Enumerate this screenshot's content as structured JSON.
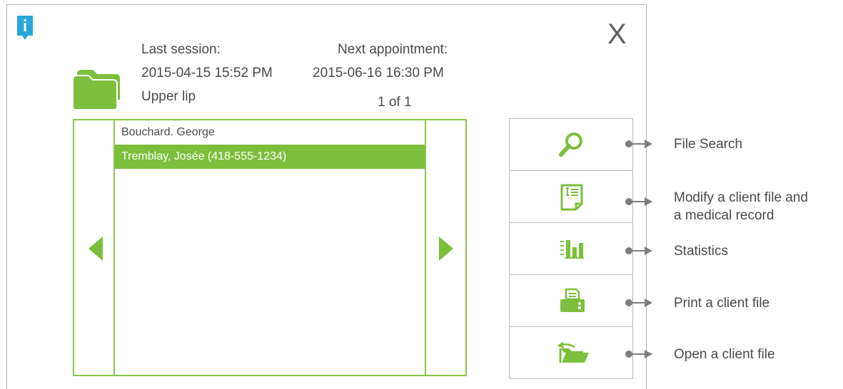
{
  "header": {
    "close_label": "X",
    "last_session_label": "Last session:",
    "next_appointment_label": "Next appointment:",
    "last_session_value": "2015-04-15 15:52 PM",
    "next_appointment_value": "2015-06-16 16:30 PM",
    "treatment_area": "Upper lip",
    "pager": "1 of 1"
  },
  "clients": [
    {
      "name": "Bouchard. George",
      "selected": false
    },
    {
      "name": "Tremblay, Josée (418-555-1234)",
      "selected": true
    }
  ],
  "tools": [
    {
      "icon": "magnifier-icon",
      "label": "File Search"
    },
    {
      "icon": "edit-document-icon",
      "label_line1": "Modify a client file and",
      "label_line2": "a medical record"
    },
    {
      "icon": "bar-chart-icon",
      "label": "Statistics"
    },
    {
      "icon": "printer-icon",
      "label": "Print a client file"
    },
    {
      "icon": "open-folder-icon",
      "label": "Open a client file"
    }
  ],
  "colors": {
    "accent_green": "#7cbf3c",
    "info_badge": "#29a7d9",
    "border_gray": "#b0b0b0",
    "text_gray": "#4a4a4a"
  }
}
